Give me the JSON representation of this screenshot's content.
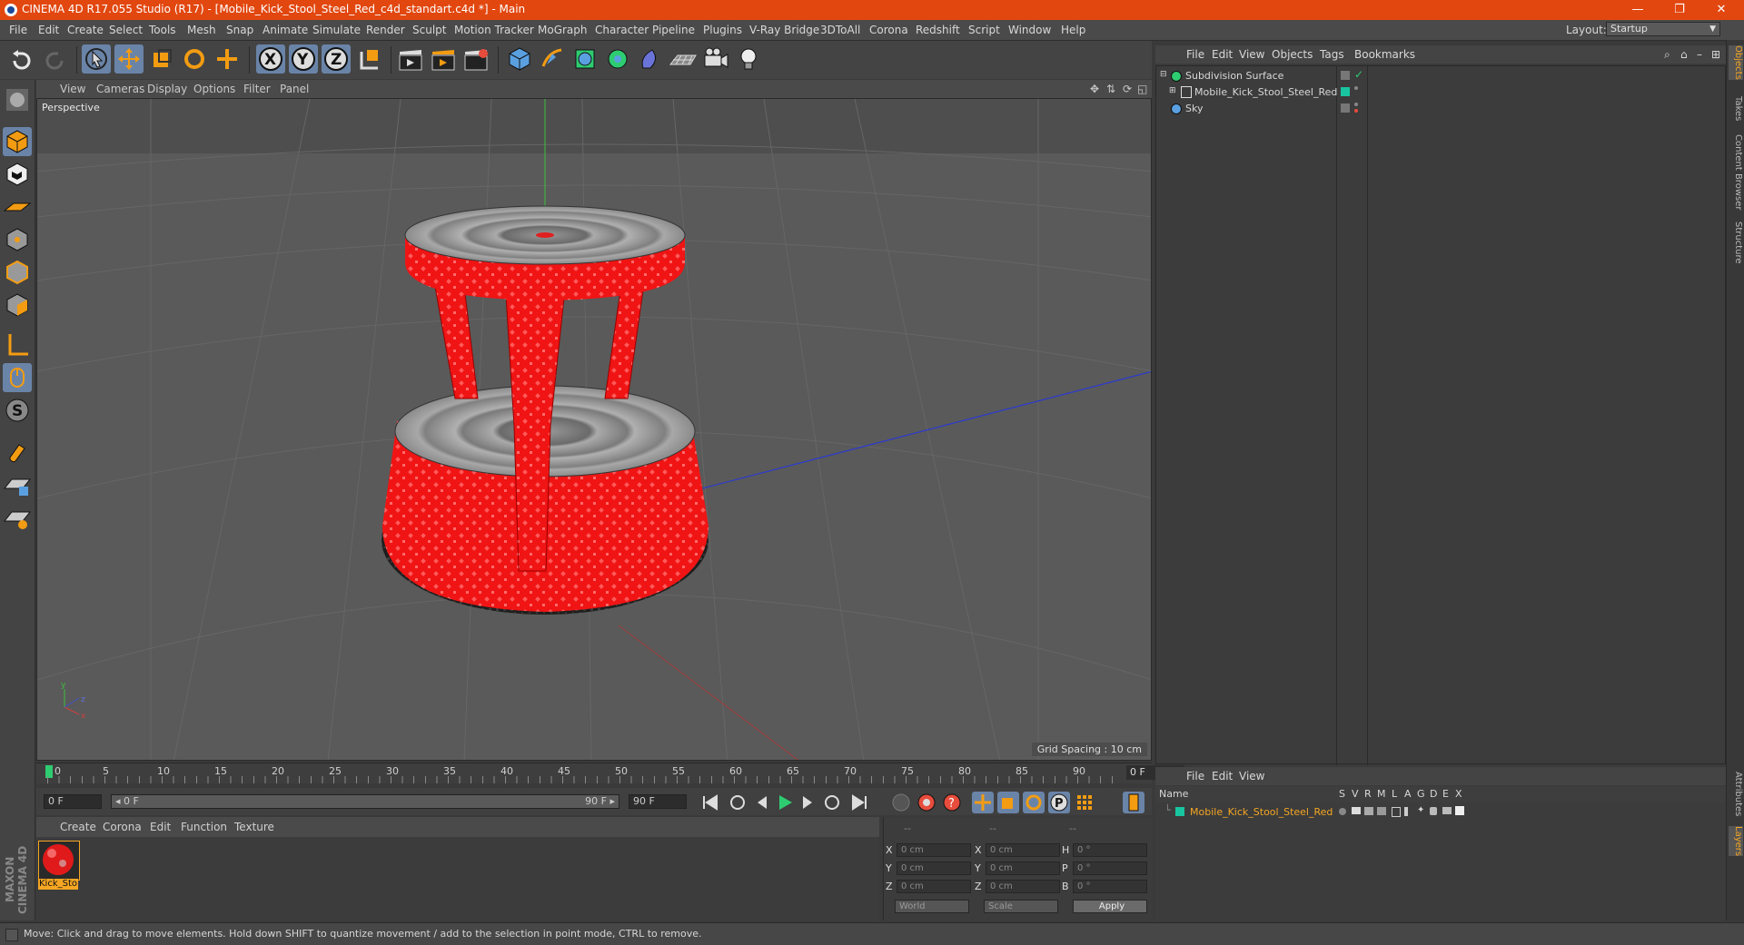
{
  "window": {
    "title": "CINEMA 4D R17.055 Studio (R17) - [Mobile_Kick_Stool_Steel_Red_c4d_standart.c4d *] - Main",
    "minimize": "—",
    "restore": "❐",
    "close": "✕"
  },
  "menu": [
    "File",
    "Edit",
    "Create",
    "Select",
    "Tools",
    "Mesh",
    "Snap",
    "Animate",
    "Simulate",
    "Render",
    "Sculpt",
    "Motion Tracker",
    "MoGraph",
    "Character",
    "Pipeline",
    "Plugins",
    "V-Ray Bridge",
    "3DToAll",
    "Corona",
    "Redshift",
    "Script",
    "Window",
    "Help"
  ],
  "layout": {
    "label": "Layout:",
    "value": "Startup"
  },
  "viewport": {
    "menu": [
      "View",
      "Cameras",
      "Display",
      "Options",
      "Filter",
      "Panel"
    ],
    "camera": "Perspective",
    "grid_spacing": "Grid Spacing : 10 cm"
  },
  "timeline": {
    "ticks": [
      "0",
      "5",
      "10",
      "15",
      "20",
      "25",
      "30",
      "35",
      "40",
      "45",
      "50",
      "55",
      "60",
      "65",
      "70",
      "75",
      "80",
      "85",
      "90"
    ],
    "current_frame": "0 F"
  },
  "playback": {
    "start": "0 F",
    "range_start": "◂ 0 F",
    "range_end": "90 F ▸",
    "end": "90 F"
  },
  "materials": {
    "menu": [
      "Create",
      "Corona",
      "Edit",
      "Function",
      "Texture"
    ],
    "items": [
      {
        "name": "Kick_Sto"
      }
    ]
  },
  "coordinates": {
    "header": [
      "--",
      "--",
      "--"
    ],
    "rows": [
      {
        "a": "X",
        "av": "0 cm",
        "b": "X",
        "bv": "0 cm",
        "c": "H",
        "cv": "0 °"
      },
      {
        "a": "Y",
        "av": "0 cm",
        "b": "Y",
        "bv": "0 cm",
        "c": "P",
        "cv": "0 °"
      },
      {
        "a": "Z",
        "av": "0 cm",
        "b": "Z",
        "bv": "0 cm",
        "c": "B",
        "cv": "0 °"
      }
    ],
    "world": "World",
    "scale": "Scale",
    "apply": "Apply"
  },
  "objects": {
    "menu": [
      "File",
      "Edit",
      "View",
      "Objects",
      "Tags",
      "Bookmarks"
    ],
    "items": [
      {
        "name": "Subdivision Surface"
      },
      {
        "name": "Mobile_Kick_Stool_Steel_Red"
      },
      {
        "name": "Sky"
      }
    ]
  },
  "layers": {
    "menu": [
      "File",
      "Edit",
      "View"
    ],
    "headers": [
      "Name",
      "S",
      "V",
      "R",
      "M",
      "L",
      "A",
      "G",
      "D",
      "E",
      "X"
    ],
    "items": [
      {
        "name": "Mobile_Kick_Stool_Steel_Red"
      }
    ]
  },
  "side_tabs": [
    "Objects",
    "Takes",
    "Content Browser",
    "Structure"
  ],
  "side_tabs_bottom": [
    "Attributes",
    "Layers"
  ],
  "status": "Move: Click and drag to move elements. Hold down SHIFT to quantize movement / add to the selection in point mode, CTRL to remove.",
  "branding": "MAXON CINEMA 4D",
  "colors": {
    "titlebar": "#e2470f",
    "accent_selected": "#6a84a8",
    "layer_color": "#19c4a0",
    "material_highlight": "#f5a623",
    "stool_red": "#f01010"
  }
}
